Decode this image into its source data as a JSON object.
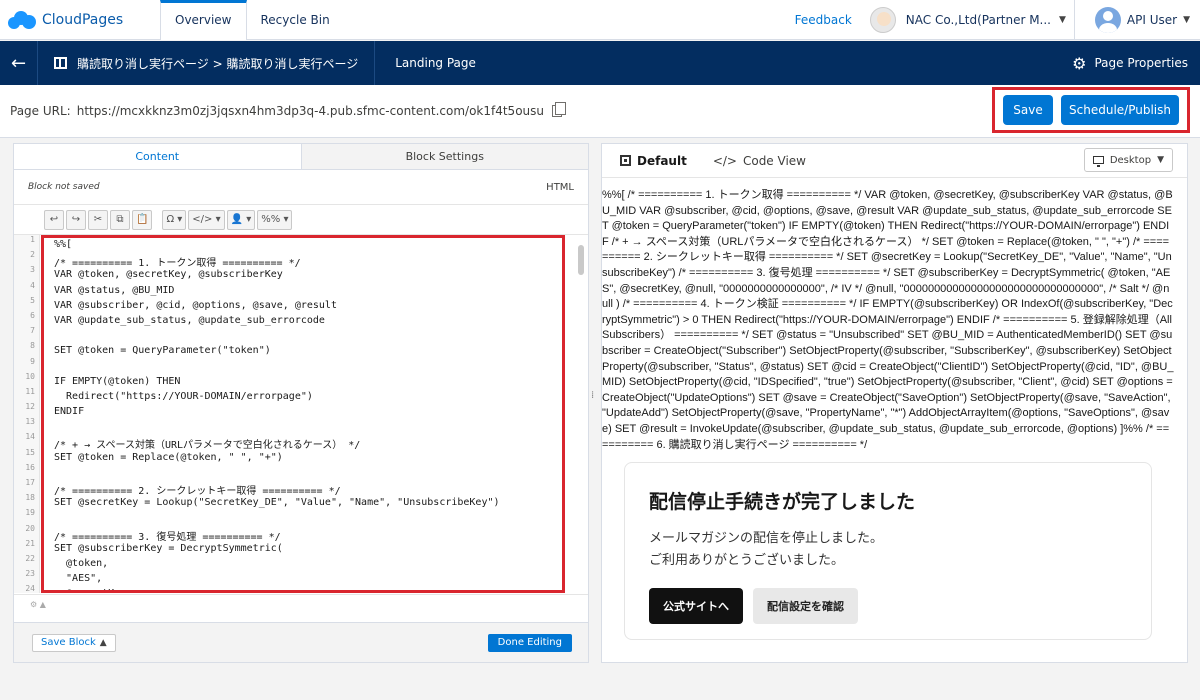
{
  "topbar": {
    "brand": "CloudPages",
    "tabs": [
      "Overview",
      "Recycle Bin"
    ],
    "feedback": "Feedback",
    "org": "NAC Co.,Ltd(Partner M...",
    "user": "API User"
  },
  "navbar": {
    "breadcrumb": "購読取り消し実行ページ > 購読取り消し実行ページ",
    "page_type": "Landing Page",
    "page_properties": "Page Properties"
  },
  "urlbar": {
    "label": "Page URL:",
    "url": "https://mcxkknz3m0zj3jqsxn4hm3dp3q-4.pub.sfmc-content.com/ok1f4t5ousu",
    "save": "Save",
    "publish": "Schedule/Publish"
  },
  "editor": {
    "tabs": [
      "Content",
      "Block Settings"
    ],
    "status": "Block not saved",
    "mode": "HTML",
    "toolbar": [
      "↩",
      "↪",
      "✂",
      "⧉",
      "📋",
      "Ω ▾",
      "</> ▾",
      "👤 ▾",
      "%% ▾"
    ],
    "line_numbers": [
      "1",
      "2",
      "3",
      "4",
      "5",
      "6",
      "7",
      "8",
      "9",
      "10",
      "11",
      "12",
      "13",
      "14",
      "15",
      "16",
      "17",
      "18",
      "19",
      "20",
      "21",
      "22",
      "23",
      "24"
    ],
    "code_lines": [
      "%%[",
      "/* ========== 1. トークン取得 ========== */",
      "VAR @token, @secretKey, @subscriberKey",
      "VAR @status, @BU_MID",
      "VAR @subscriber, @cid, @options, @save, @result",
      "VAR @update_sub_status, @update_sub_errorcode",
      "",
      "SET @token = QueryParameter(\"token\")",
      "",
      "IF EMPTY(@token) THEN",
      "  Redirect(\"https://YOUR-DOMAIN/errorpage\")",
      "ENDIF",
      "",
      "/* + → スペース対策（URLパラメータで空白化されるケース） */",
      "SET @token = Replace(@token, \" \", \"+\")",
      "",
      "/* ========== 2. シークレットキー取得 ========== */",
      "SET @secretKey = Lookup(\"SecretKey_DE\", \"Value\", \"Name\", \"UnsubscribeKey\")",
      "",
      "/* ========== 3. 復号処理 ========== */",
      "SET @subscriberKey = DecryptSymmetric(",
      "  @token,",
      "  \"AES\",",
      "  @secretKey,"
    ],
    "save_block": "Save Block",
    "done": "Done Editing"
  },
  "preview": {
    "tabs": [
      "Default",
      "Code View"
    ],
    "device": "Desktop",
    "raw_text": "%%[ /* ========== 1. トークン取得 ========== */ VAR @token, @secretKey, @subscriberKey VAR @status, @BU_MID VAR @subscriber, @cid, @options, @save, @result VAR @update_sub_status, @update_sub_errorcode SET @token = QueryParameter(\"token\") IF EMPTY(@token) THEN Redirect(\"https://YOUR-DOMAIN/errorpage\") ENDIF /* + → スペース対策（URLパラメータで空白化されるケース） */ SET @token = Replace(@token, \" \", \"+\") /* ========== 2. シークレットキー取得 ========== */ SET @secretKey = Lookup(\"SecretKey_DE\", \"Value\", \"Name\", \"UnsubscribeKey\") /* ========== 3. 復号処理 ========== */ SET @subscriberKey = DecryptSymmetric( @token, \"AES\", @secretKey, @null, \"0000000000000000\", /* IV */ @null, \"00000000000000000000000000000000\", /* Salt */ @null ) /* ========== 4. トークン検証 ========== */ IF EMPTY(@subscriberKey) OR IndexOf(@subscriberKey, \"DecryptSymmetric\") > 0 THEN Redirect(\"https://YOUR-DOMAIN/errorpage\") ENDIF /* ========== 5. 登録解除処理（All Subscribers） ========== */ SET @status = \"Unsubscribed\" SET @BU_MID = AuthenticatedMemberID() SET @subscriber = CreateObject(\"Subscriber\") SetObjectProperty(@subscriber, \"SubscriberKey\", @subscriberKey) SetObjectProperty(@subscriber, \"Status\", @status) SET @cid = CreateObject(\"ClientID\") SetObjectProperty(@cid, \"ID\", @BU_MID) SetObjectProperty(@cid, \"IDSpecified\", \"true\") SetObjectProperty(@subscriber, \"Client\", @cid) SET @options = CreateObject(\"UpdateOptions\") SET @save = CreateObject(\"SaveOption\") SetObjectProperty(@save, \"SaveAction\", \"UpdateAdd\") SetObjectProperty(@save, \"PropertyName\", \"*\") AddObjectArrayItem(@options, \"SaveOptions\", @save) SET @result = InvokeUpdate(@subscriber, @update_sub_status, @update_sub_errorcode, @options) ]%% /* ========== 6. 購読取り消し実行ページ ========== */",
    "card": {
      "title": "配信停止手続きが完了しました",
      "line1": "メールマガジンの配信を停止しました。",
      "line2": "ご利用ありがとうございました。",
      "btn_primary": "公式サイトへ",
      "btn_secondary": "配信設定を確認"
    }
  }
}
